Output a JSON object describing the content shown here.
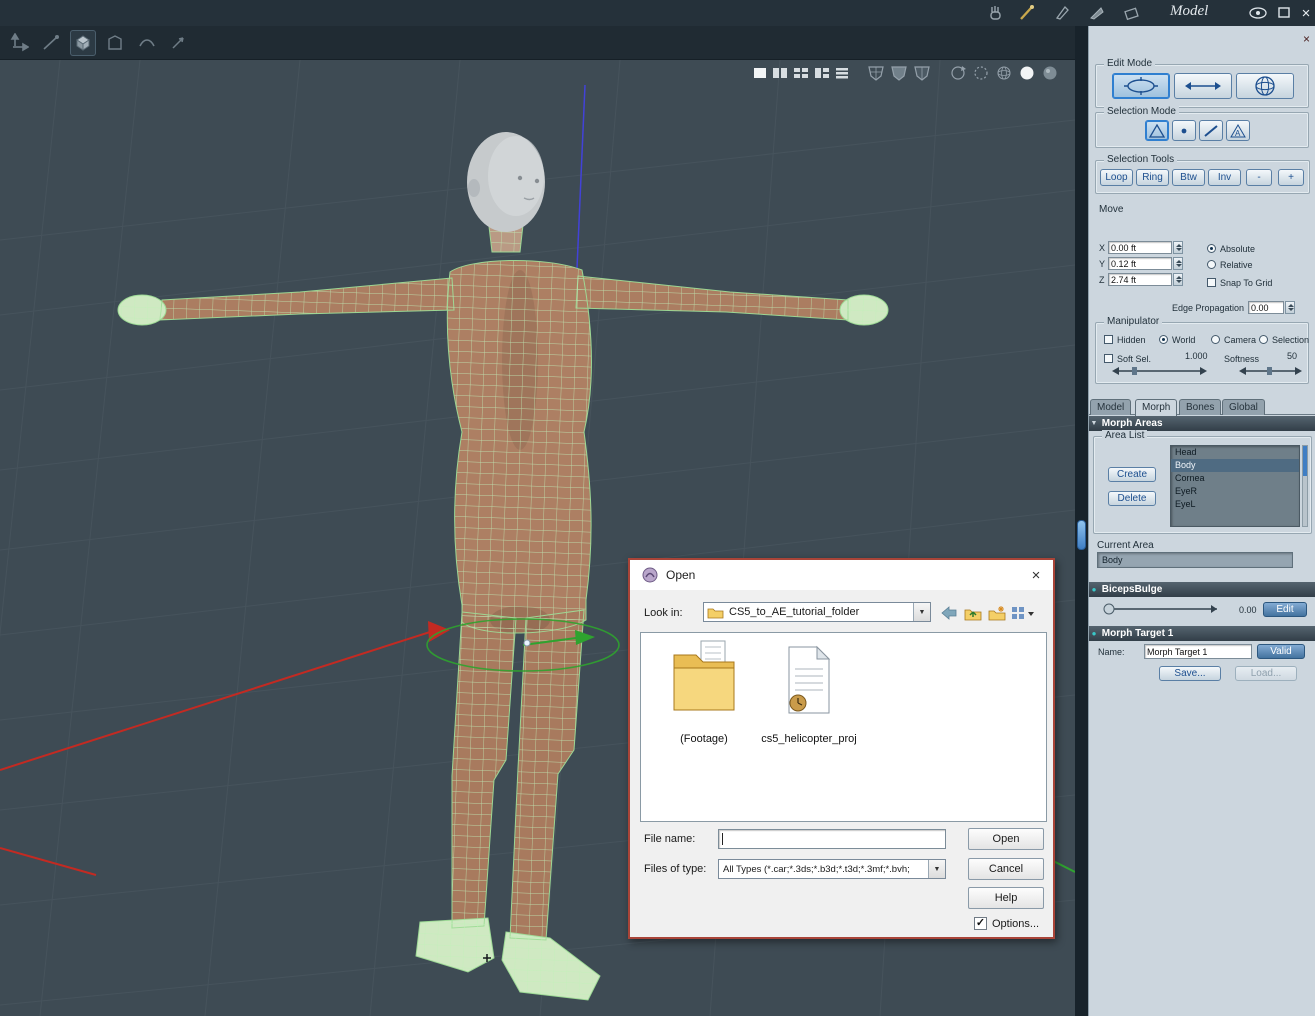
{
  "icons": {
    "close": "×",
    "dropdown": "▼",
    "check": "✓",
    "bullet": "●",
    "collapse": "▼"
  },
  "titlebar": {
    "title": "Model"
  },
  "panel": {
    "edit_mode": {
      "label": "Edit Mode"
    },
    "selection_mode": {
      "label": "Selection Mode"
    },
    "selection_tools": {
      "label": "Selection Tools",
      "buttons": [
        "Loop",
        "Ring",
        "Btw",
        "Inv",
        "-",
        "+"
      ]
    },
    "move": {
      "label": "Move",
      "axes": [
        {
          "axis": "X",
          "value": "0.00 ft"
        },
        {
          "axis": "Y",
          "value": "0.12 ft"
        },
        {
          "axis": "Z",
          "value": "2.74 ft"
        }
      ],
      "absolute": "Absolute",
      "relative": "Relative",
      "snap": "Snap To Grid",
      "edge_propagation_label": "Edge Propagation",
      "edge_propagation_value": "0.00"
    },
    "manipulator": {
      "label": "Manipulator",
      "hidden": "Hidden",
      "world": "World",
      "camera": "Camera",
      "selection": "Selection",
      "soft_sel": "Soft Sel.",
      "soft_value": "1.000",
      "softness": "Softness",
      "softness_value": "50"
    },
    "tabs": [
      {
        "label": "Model",
        "active": false
      },
      {
        "label": "Morph",
        "active": true
      },
      {
        "label": "Bones",
        "active": false
      },
      {
        "label": "Global",
        "active": false
      }
    ],
    "morph_areas": {
      "header": "Morph Areas",
      "area_list_label": "Area List",
      "create": "Create",
      "delete": "Delete",
      "areas": [
        "Head",
        "Body",
        "Cornea",
        "EyeR",
        "EyeL"
      ],
      "selected_area": "Body",
      "current_area_label": "Current Area",
      "current_area_value": "Body"
    },
    "biceps": {
      "header": "BicepsBulge",
      "value": "0.00",
      "edit": "Edit"
    },
    "morph_target": {
      "header": "Morph Target 1",
      "name_label": "Name:",
      "name_value": "Morph Target 1",
      "valid": "Valid",
      "save": "Save...",
      "load": "Load..."
    }
  },
  "dialog": {
    "title": "Open",
    "look_in_label": "Look in:",
    "look_in_value": "CS5_to_AE_tutorial_folder",
    "items": [
      {
        "label": "(Footage)"
      },
      {
        "label": "cs5_helicopter_proj"
      }
    ],
    "file_name_label": "File name:",
    "file_name_value": "",
    "files_of_type_label": "Files of type:",
    "files_of_type_value": "All Types (*.car;*.3ds;*.b3d;*.t3d;*.3mf;*.bvh;",
    "open": "Open",
    "cancel": "Cancel",
    "help": "Help",
    "options": "Options..."
  },
  "colors": {
    "accent_blue": "#3f7ec4",
    "panel_bg": "#ccd6de",
    "viewport_bg": "#3e4b54",
    "mesh_green": "#c2f0ba",
    "body_tan": "#ad7f63",
    "axis_red": "#c32a22",
    "axis_green": "#2fa32f",
    "axis_blue": "#4242d8"
  }
}
